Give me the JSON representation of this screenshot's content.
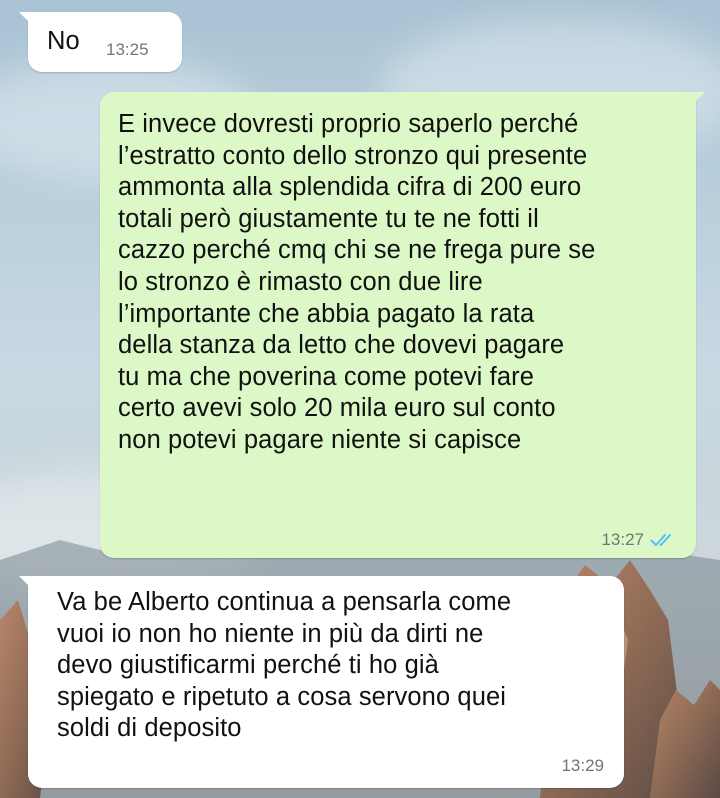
{
  "chat": {
    "messages": [
      {
        "direction": "incoming",
        "text": "No",
        "time": "13:25"
      },
      {
        "direction": "outgoing",
        "text": "E invece dovresti proprio saperlo perché\nl’estratto conto dello stronzo qui presente\nammonta alla splendida cifra di 200 euro\ntotali però giustamente tu te ne fotti il\ncazzo perché cmq chi se ne frega pure se\nlo stronzo è rimasto con due lire\nl’importante che abbia pagato la rata\ndella stanza da letto che dovevi pagare\ntu ma che poverina come potevi fare\ncerto avevi solo 20 mila euro sul conto\nnon potevi pagare niente si capisce",
        "time": "13:27",
        "status_icon": "double-check-read-icon",
        "status_color": "#4fc3f7"
      },
      {
        "direction": "incoming",
        "text": "Va be Alberto continua a pensarla come\nvuoi io non ho niente in più da dirti ne\ndevo giustificarmi perché ti ho già\nspiegato e ripetuto a cosa servono quei\nsoldi di deposito",
        "time": "13:29"
      }
    ]
  },
  "theme": {
    "incoming_bubble": "#ffffff",
    "outgoing_bubble": "#dcf8c6",
    "time_color": "#6b7a70"
  }
}
